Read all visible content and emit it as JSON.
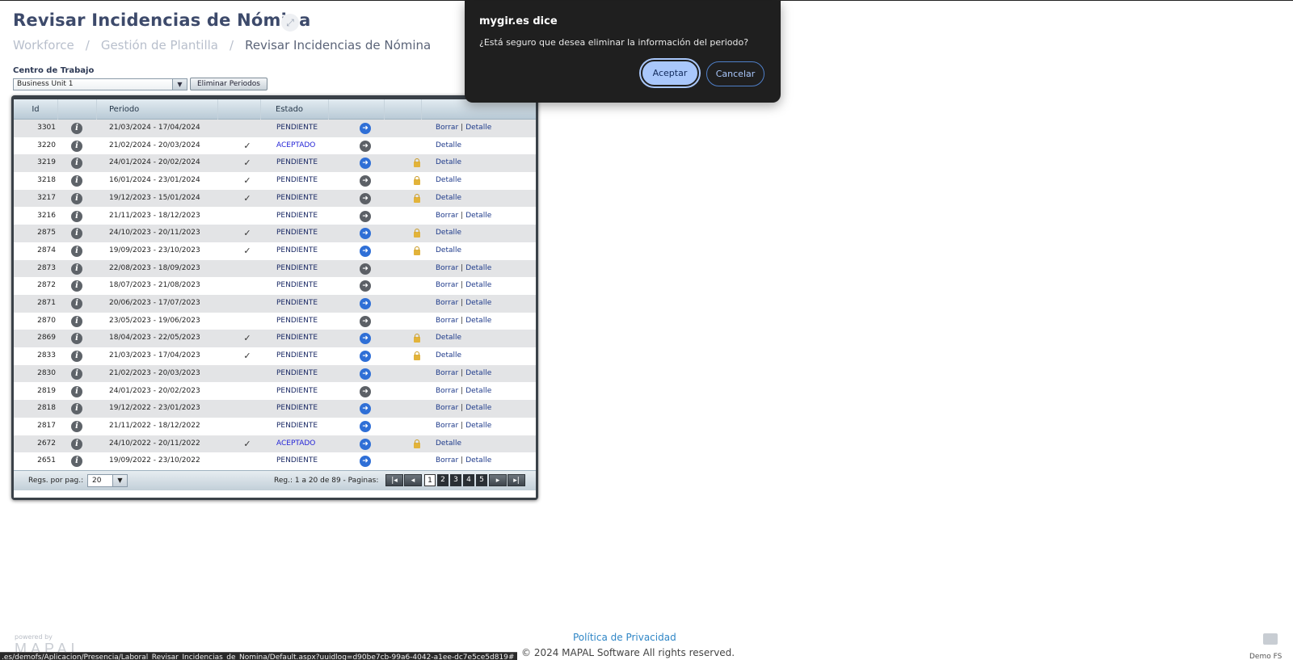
{
  "page": {
    "title": "Revisar Incidencias de Nómina",
    "expand_icon": "expand-icon"
  },
  "breadcrumb": [
    {
      "label": "Workforce"
    },
    {
      "label": "Gestión de Plantilla"
    },
    {
      "label": "Revisar Incidencias de Nómina"
    }
  ],
  "breadcrumb_sep": "/",
  "filters": {
    "centro_label": "Centro de Trabajo",
    "centro_value": "Business Unit 1",
    "eliminar_button": "Eliminar Periodos"
  },
  "grid": {
    "headers": {
      "id": "Id",
      "periodo": "Periodo",
      "estado": "Estado"
    },
    "rows": [
      {
        "id": "3301",
        "periodo": "21/03/2024 - 17/04/2024",
        "check": "",
        "estado": "PENDIENTE",
        "arrow": "blue",
        "lock": false,
        "borrar": "Borrar",
        "detalle": "Detalle"
      },
      {
        "id": "3220",
        "periodo": "21/02/2024 - 20/03/2024",
        "check": "✓",
        "estado": "ACEPTADO",
        "arrow": "gray",
        "lock": false,
        "borrar": "",
        "detalle": "Detalle"
      },
      {
        "id": "3219",
        "periodo": "24/01/2024 - 20/02/2024",
        "check": "✓",
        "estado": "PENDIENTE",
        "arrow": "blue",
        "lock": true,
        "borrar": "",
        "detalle": "Detalle"
      },
      {
        "id": "3218",
        "periodo": "16/01/2024 - 23/01/2024",
        "check": "✓",
        "estado": "PENDIENTE",
        "arrow": "gray",
        "lock": true,
        "borrar": "",
        "detalle": "Detalle"
      },
      {
        "id": "3217",
        "periodo": "19/12/2023 - 15/01/2024",
        "check": "✓",
        "estado": "PENDIENTE",
        "arrow": "gray",
        "lock": true,
        "borrar": "",
        "detalle": "Detalle"
      },
      {
        "id": "3216",
        "periodo": "21/11/2023 - 18/12/2023",
        "check": "",
        "estado": "PENDIENTE",
        "arrow": "gray",
        "lock": false,
        "borrar": "Borrar",
        "detalle": "Detalle"
      },
      {
        "id": "2875",
        "periodo": "24/10/2023 - 20/11/2023",
        "check": "✓",
        "estado": "PENDIENTE",
        "arrow": "blue",
        "lock": true,
        "borrar": "",
        "detalle": "Detalle"
      },
      {
        "id": "2874",
        "periodo": "19/09/2023 - 23/10/2023",
        "check": "✓",
        "estado": "PENDIENTE",
        "arrow": "blue",
        "lock": true,
        "borrar": "",
        "detalle": "Detalle"
      },
      {
        "id": "2873",
        "periodo": "22/08/2023 - 18/09/2023",
        "check": "",
        "estado": "PENDIENTE",
        "arrow": "gray",
        "lock": false,
        "borrar": "Borrar",
        "detalle": "Detalle"
      },
      {
        "id": "2872",
        "periodo": "18/07/2023 - 21/08/2023",
        "check": "",
        "estado": "PENDIENTE",
        "arrow": "gray",
        "lock": false,
        "borrar": "Borrar",
        "detalle": "Detalle"
      },
      {
        "id": "2871",
        "periodo": "20/06/2023 - 17/07/2023",
        "check": "",
        "estado": "PENDIENTE",
        "arrow": "blue",
        "lock": false,
        "borrar": "Borrar",
        "detalle": "Detalle"
      },
      {
        "id": "2870",
        "periodo": "23/05/2023 - 19/06/2023",
        "check": "",
        "estado": "PENDIENTE",
        "arrow": "gray",
        "lock": false,
        "borrar": "Borrar",
        "detalle": "Detalle"
      },
      {
        "id": "2869",
        "periodo": "18/04/2023 - 22/05/2023",
        "check": "✓",
        "estado": "PENDIENTE",
        "arrow": "blue",
        "lock": true,
        "borrar": "",
        "detalle": "Detalle"
      },
      {
        "id": "2833",
        "periodo": "21/03/2023 - 17/04/2023",
        "check": "✓",
        "estado": "PENDIENTE",
        "arrow": "blue",
        "lock": true,
        "borrar": "",
        "detalle": "Detalle"
      },
      {
        "id": "2830",
        "periodo": "21/02/2023 - 20/03/2023",
        "check": "",
        "estado": "PENDIENTE",
        "arrow": "blue",
        "lock": false,
        "borrar": "Borrar",
        "detalle": "Detalle"
      },
      {
        "id": "2819",
        "periodo": "24/01/2023 - 20/02/2023",
        "check": "",
        "estado": "PENDIENTE",
        "arrow": "gray",
        "lock": false,
        "borrar": "Borrar",
        "detalle": "Detalle"
      },
      {
        "id": "2818",
        "periodo": "19/12/2022 - 23/01/2023",
        "check": "",
        "estado": "PENDIENTE",
        "arrow": "blue",
        "lock": false,
        "borrar": "Borrar",
        "detalle": "Detalle"
      },
      {
        "id": "2817",
        "periodo": "21/11/2022 - 18/12/2022",
        "check": "",
        "estado": "PENDIENTE",
        "arrow": "blue",
        "lock": false,
        "borrar": "Borrar",
        "detalle": "Detalle"
      },
      {
        "id": "2672",
        "periodo": "24/10/2022 - 20/11/2022",
        "check": "✓",
        "estado": "ACEPTADO",
        "arrow": "blue",
        "lock": true,
        "borrar": "",
        "detalle": "Detalle"
      },
      {
        "id": "2651",
        "periodo": "19/09/2022 - 23/10/2022",
        "check": "",
        "estado": "PENDIENTE",
        "arrow": "blue",
        "lock": false,
        "borrar": "Borrar",
        "detalle": "Detalle"
      }
    ],
    "footer": {
      "per_page_label": "Regs. por pag.:",
      "per_page_value": "20",
      "reg_info": "Reg.: 1 a 20 de 89 - Paginas:",
      "pages": [
        "1",
        "2",
        "3",
        "4",
        "5"
      ],
      "current_page": "1"
    }
  },
  "dialog": {
    "title": "mygir.es dice",
    "message": "¿Está seguro que desea eliminar la información del periodo?",
    "accept": "Aceptar",
    "cancel": "Cancelar"
  },
  "footer": {
    "privacy": "Política de Privacidad",
    "copyright": "© 2024 MAPAL Software All rights reserved.",
    "powered_by": "powered by",
    "brand": "MAPAL",
    "demo_label": "Demo FS"
  },
  "status_url": ".es/demofs/Aplicacion/Presencia/Laboral_Revisar_Incidencias_de_Nomina/Default.aspx?uuidlog=d90be7cb-99a6-4042-a1ee-dc7e5ce5d819#",
  "colors": {
    "accent": "#2f6fd6",
    "title": "#3d4a6b",
    "dialog_bg": "#1f1f1f",
    "accept_bg": "#a9c7fb",
    "aceptado": "#2424d6"
  }
}
